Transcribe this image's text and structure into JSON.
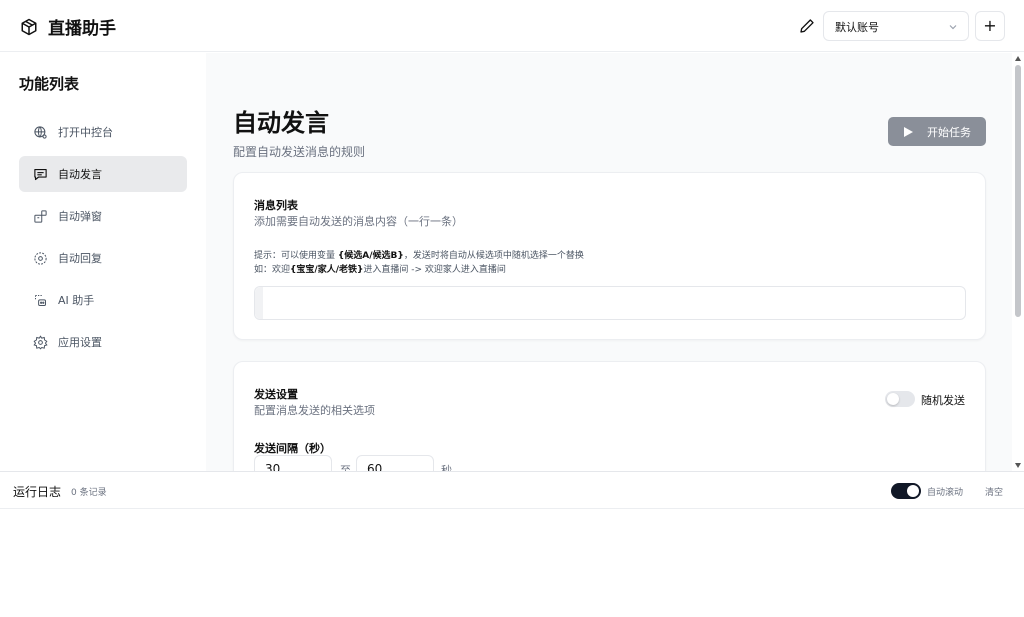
{
  "header": {
    "app_title": "直播助手",
    "account_selected": "默认账号",
    "add_label": "+",
    "icons": {
      "brand": "cube-icon",
      "edit": "pencil-icon",
      "dropdown": "chevron-down-icon"
    }
  },
  "sidebar": {
    "title": "功能列表",
    "items": [
      {
        "label": "打开中控台",
        "icon": "globe-icon",
        "active": false
      },
      {
        "label": "自动发言",
        "icon": "message-square-icon",
        "active": true
      },
      {
        "label": "自动弹窗",
        "icon": "package-icon",
        "active": false
      },
      {
        "label": "自动回复",
        "icon": "message-circle-icon",
        "active": false
      },
      {
        "label": "AI 助手",
        "icon": "bot-icon",
        "active": false
      },
      {
        "label": "应用设置",
        "icon": "gear-icon",
        "active": false
      }
    ]
  },
  "main": {
    "title": "自动发言",
    "subtitle": "配置自动发送消息的规则",
    "start_button": "开始任务",
    "message_card": {
      "title": "消息列表",
      "desc": "添加需要自动发送的消息内容（一行一条）",
      "hint_prefix": "提示：可以使用变量 ",
      "hint_variable": "{候选A/候选B}",
      "hint_suffix": "，发送时将自动从候选项中随机选择一个替换",
      "example_prefix": "如：欢迎",
      "example_variable": "{宝宝/家人/老铁}",
      "example_suffix": "进入直播间 -> 欢迎家人进入直播间",
      "textarea_value": ""
    },
    "send_card": {
      "title": "发送设置",
      "desc": "配置消息发送的相关选项",
      "random_label": "随机发送",
      "random_enabled": false,
      "interval_label": "发送间隔（秒）",
      "interval_min": "30",
      "interval_to": "至",
      "interval_max": "60",
      "interval_unit": "秒"
    }
  },
  "log": {
    "title": "运行日志",
    "count": "0 条记录",
    "auto_scroll_label": "自动滚动",
    "auto_scroll_enabled": true,
    "clear_label": "清空"
  },
  "colors": {
    "start_button_bg": "#8a8f99",
    "active_nav_bg": "#e9eaec",
    "toggle_on": "#111827"
  }
}
